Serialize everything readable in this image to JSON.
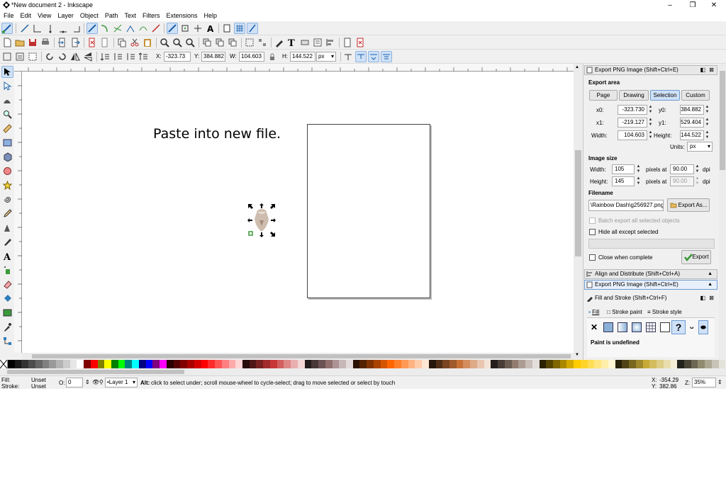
{
  "window": {
    "title": "*New document 2 - Inkscape",
    "controls": [
      "–",
      "❐",
      "✕"
    ]
  },
  "menu": [
    "File",
    "Edit",
    "View",
    "Layer",
    "Object",
    "Path",
    "Text",
    "Filters",
    "Extensions",
    "Help"
  ],
  "select_toolbar": {
    "x_label": "X:",
    "x_value": "-323.73",
    "y_label": "Y:",
    "y_value": "384.882",
    "w_label": "W:",
    "w_value": "104.603",
    "h_label": "H:",
    "h_value": "144.522",
    "units": "px"
  },
  "canvas": {
    "annotation": "Paste into new file."
  },
  "export_panel": {
    "title": "Export PNG Image (Shift+Ctrl+E)",
    "export_area_heading": "Export area",
    "area_buttons": [
      "Page",
      "Drawing",
      "Selection",
      "Custom"
    ],
    "active_area": "Selection",
    "x0_label": "x0:",
    "x0": "-323.730",
    "y0_label": "y0:",
    "y0": "384.882",
    "x1_label": "x1:",
    "x1": "-219.127",
    "y1_label": "y1:",
    "y1": "529.404",
    "width_label": "Width:",
    "width": "104.603",
    "height_label": "Height:",
    "height": "144.522",
    "units_label": "Units:",
    "units": "px",
    "image_size_heading": "Image size",
    "img_width_label": "Width:",
    "img_width": "105",
    "img_height_label": "Height:",
    "img_height": "145",
    "pixels_at": "pixels at",
    "dpi_value": "90.00",
    "dpi_value_disabled": "90.00",
    "dpi_label": "dpi",
    "filename_heading": "Filename",
    "filename": "\\Rainbow Dash\\g256927.png",
    "export_as_button": "Export As...",
    "batch_export_label": "Batch export all selected objects",
    "hide_all_label": "Hide all except selected",
    "close_when_complete_label": "Close when complete",
    "export_button": "Export"
  },
  "docked_tabs": {
    "align_distribute": "Align and Distribute (Shift+Ctrl+A)",
    "export_png": "Export PNG Image (Shift+Ctrl+E)"
  },
  "fill_stroke_panel": {
    "title": "Fill and Stroke (Shift+Ctrl+F)",
    "tabs": [
      "Fill",
      "Stroke paint",
      "Stroke style"
    ],
    "paint_status": "Paint is undefined"
  },
  "status": {
    "fill_label": "Fill:",
    "fill_value": "Unset",
    "stroke_label": "Stroke:",
    "stroke_value": "Unset",
    "opacity_label": "O:",
    "opacity_value": "0",
    "layer": "•Layer 1",
    "message_bold": "Alt:",
    "message": "click to select under; scroll mouse-wheel to cycle-select; drag to move selected or select by touch",
    "cursor_x_label": "X:",
    "cursor_x": "-354.29",
    "cursor_y_label": "Y:",
    "cursor_y": "382.86",
    "zoom_label": "Z:",
    "zoom_value": "35%"
  },
  "colors": {
    "accent": "#cfe1f7",
    "accent_border": "#6b9bd2",
    "palette": [
      "#000000",
      "#1a1a1a",
      "#333333",
      "#4d4d4d",
      "#666666",
      "#808080",
      "#999999",
      "#b3b3b3",
      "#cccccc",
      "#e6e6e6",
      "#ffffff",
      "#800000",
      "#ff0000",
      "#808000",
      "#ffff00",
      "#008000",
      "#00ff00",
      "#008080",
      "#00ffff",
      "#000080",
      "#0000ff",
      "#800080",
      "#ff00ff",
      "#2b0000",
      "#550000",
      "#800000",
      "#aa0000",
      "#d40000",
      "#ff0000",
      "#ff2a2a",
      "#ff5555",
      "#ff8080",
      "#ffaaaa",
      "#ffd5d5",
      "#280b0b",
      "#501616",
      "#782121",
      "#a02c2c",
      "#c83737",
      "#d35f5f",
      "#de8787",
      "#e9afaf",
      "#f4d7d7",
      "#241c1c",
      "#483737",
      "#6c5353",
      "#916f6f",
      "#ac9393",
      "#c8b7b7",
      "#e3dbdb",
      "#2b1100",
      "#552200",
      "#803300",
      "#aa4400",
      "#d45500",
      "#ff6600",
      "#ff7f2a",
      "#ff9955",
      "#ffb380",
      "#ffccaa",
      "#ffe6d5",
      "#28170b",
      "#502d16",
      "#784421",
      "#a05a2c",
      "#c87137",
      "#d38d5f",
      "#deaa87",
      "#e9c6af",
      "#f4e3d7",
      "#241f1c",
      "#483e37",
      "#6c5d53",
      "#917c6f",
      "#ac9d93",
      "#c8beb7",
      "#e3dedb",
      "#2b2200",
      "#554400",
      "#806600",
      "#aa8800",
      "#d4aa00",
      "#ffcc00",
      "#ffd42a",
      "#ffdd55",
      "#ffe680",
      "#ffeeaa",
      "#fff6d5",
      "#28220b",
      "#504416",
      "#786721",
      "#a0892c",
      "#c8ab37",
      "#d3bc5f",
      "#decd87",
      "#e9ddaf",
      "#f4eed7",
      "#24221c",
      "#484537",
      "#6c6753",
      "#918a6f",
      "#aca793",
      "#c8c4b7",
      "#e3e2db"
    ]
  }
}
